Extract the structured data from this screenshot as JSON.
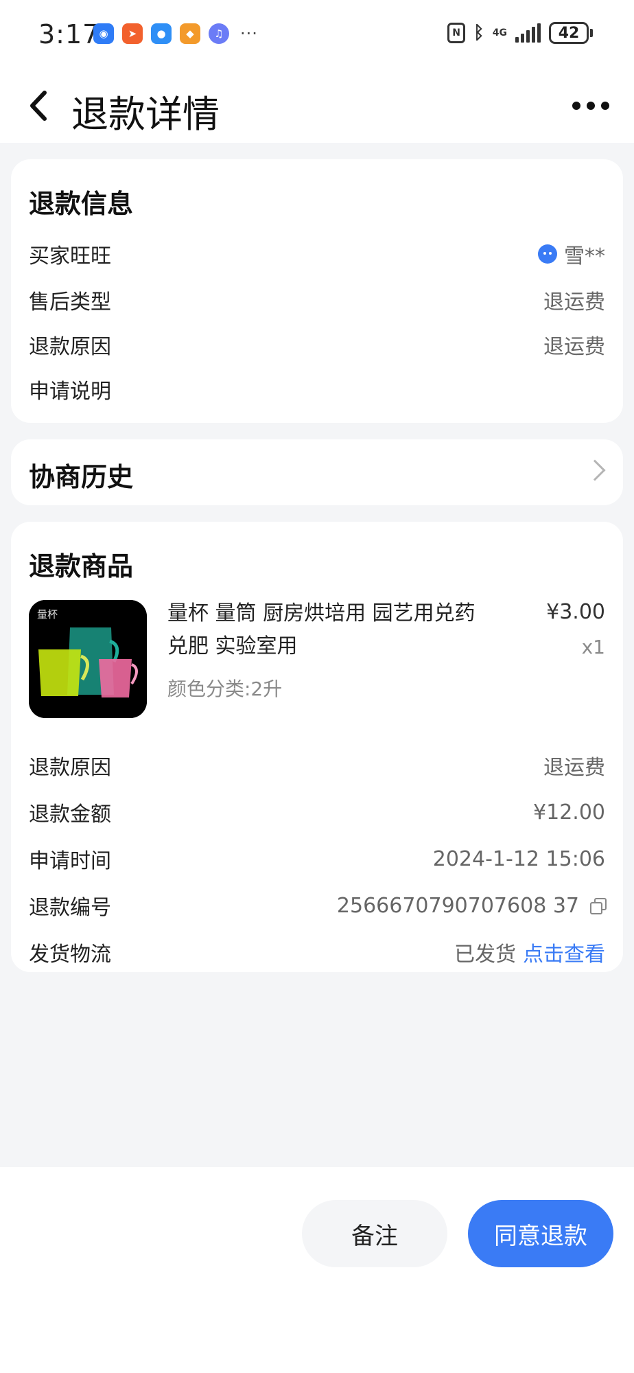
{
  "status_bar": {
    "time": "3:17",
    "more_apps": "···",
    "nfc": "N",
    "network": "4G",
    "battery": "42"
  },
  "header": {
    "title": "退款详情"
  },
  "refund_info": {
    "title": "退款信息",
    "rows": [
      {
        "label": "买家旺旺",
        "value": "雪**"
      },
      {
        "label": "售后类型",
        "value": "退运费"
      },
      {
        "label": "退款原因",
        "value": "退运费"
      },
      {
        "label": "申请说明",
        "value": ""
      }
    ]
  },
  "negotiation": {
    "title": "协商历史"
  },
  "refund_goods": {
    "title": "退款商品",
    "product": {
      "image_label": "量杯",
      "name": "量杯 量筒 厨房烘培用  园艺用兑药兑肥  实验室用",
      "spec": "颜色分类:2升",
      "price": "¥3.00",
      "quantity": "x1"
    },
    "rows": [
      {
        "label": "退款原因",
        "value": "退运费"
      },
      {
        "label": "退款金额",
        "value": "¥12.00"
      },
      {
        "label": "申请时间",
        "value": "2024-1-12 15:06"
      },
      {
        "label": "退款编号",
        "value": "2566670790707608 37"
      },
      {
        "label": "发货物流",
        "value": "已发货",
        "link": "点击查看"
      }
    ]
  },
  "actions": {
    "remark": "备注",
    "agree": "同意退款"
  },
  "colors": {
    "accent": "#3a7bf5",
    "background": "#f4f5f7",
    "card": "#ffffff"
  }
}
